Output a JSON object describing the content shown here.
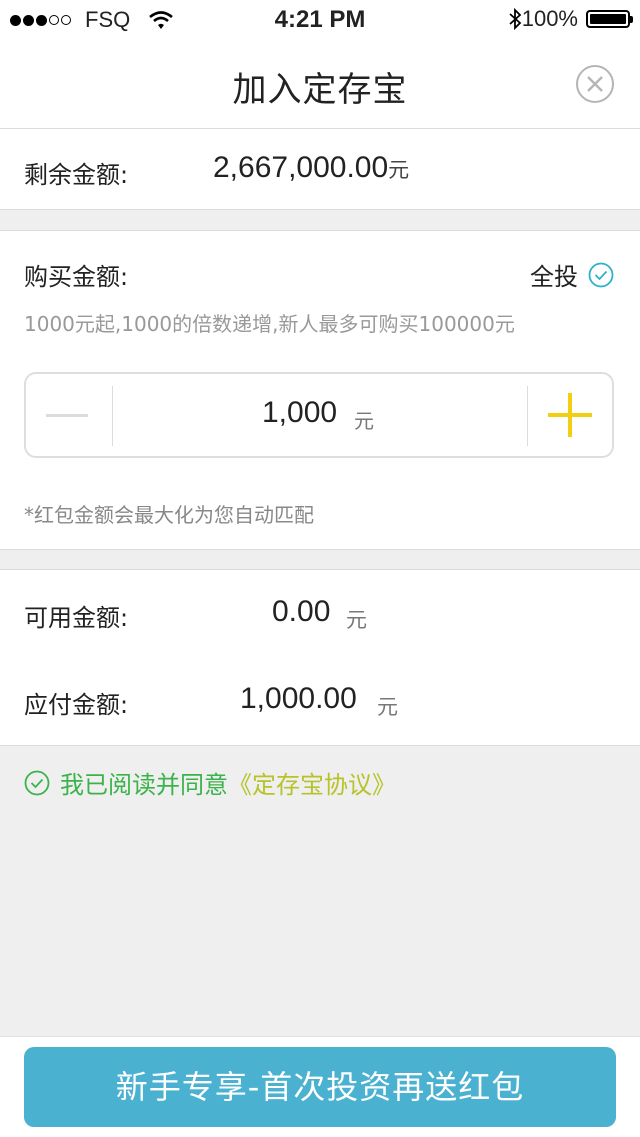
{
  "status_bar": {
    "carrier": "FSQ",
    "time": "4:21 PM",
    "battery": "100%"
  },
  "header": {
    "title": "加入定存宝",
    "close_icon": "close-circle-icon"
  },
  "remaining": {
    "label": "剩余金额:",
    "value": "2,667,000.00",
    "unit": "元"
  },
  "purchase": {
    "label": "购买金额:",
    "all_in_label": "全投",
    "hint": "1000元起,1000的倍数递增,新人最多可购买100000元",
    "stepper_value": "1,000",
    "stepper_unit": "元",
    "note": "*红包金额会最大化为您自动匹配"
  },
  "summary": {
    "available_label": "可用金额:",
    "available_value": "0.00",
    "available_unit": "元",
    "payable_label": "应付金额:",
    "payable_value": "1,000.00",
    "payable_unit": "元"
  },
  "agreement": {
    "text": "我已阅读并同意",
    "link": "《定存宝协议》"
  },
  "cta": {
    "label": "新手专享-首次投资再送红包"
  },
  "colors": {
    "accent_blue": "#4bb1d1",
    "plus_yellow": "#f3cf14",
    "agree_green": "#3bb34a",
    "link_olive": "#b8c22a",
    "check_teal": "#2bb3c9"
  }
}
